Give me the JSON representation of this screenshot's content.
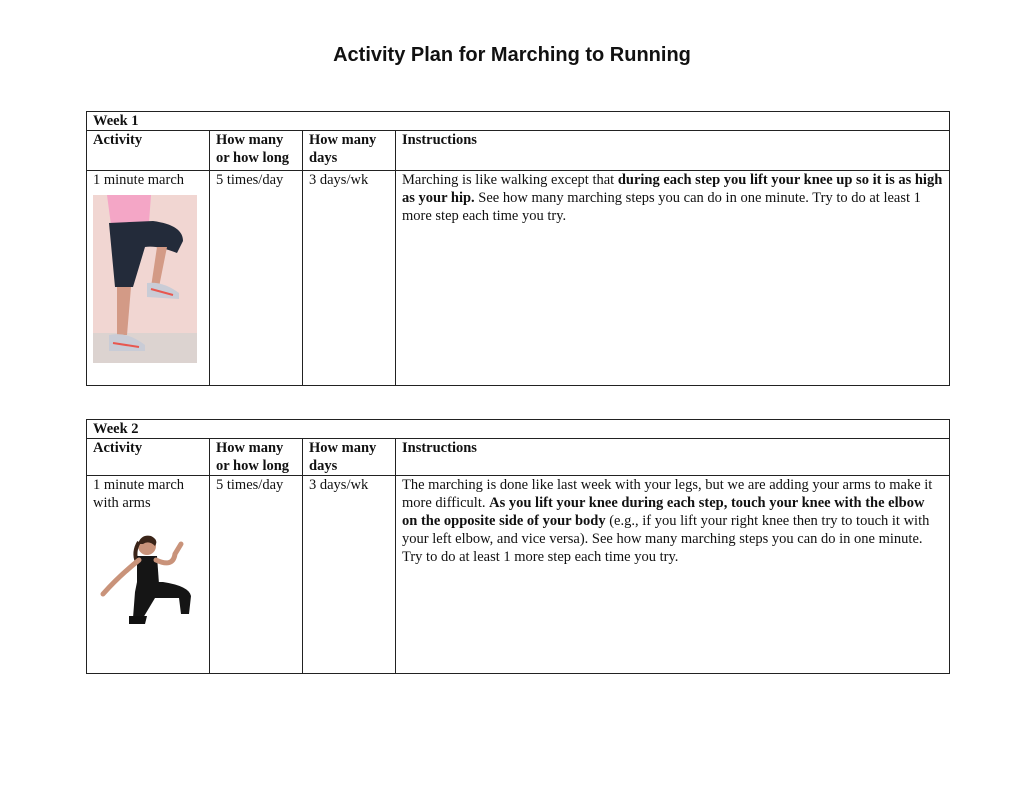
{
  "document": {
    "title": "Activity Plan for Marching to Running"
  },
  "headers": {
    "activity": "Activity",
    "how_many_line1": "How many",
    "how_many_line2": "or how long",
    "days_line1": "How many",
    "days_line2": "days",
    "instructions": "Instructions"
  },
  "weeks": [
    {
      "label": "Week 1",
      "activity_line1": "1 minute march",
      "activity_line2": "",
      "how_many": "5 times/day",
      "days": "3 days/wk",
      "instructions": {
        "p1": "Marching is like walking except that ",
        "b1": "during each step you lift your knee up so it is as high as your hip.",
        "p2": " See how many marching steps you can do in one minute. Try to do at least 1 more step each time you try."
      }
    },
    {
      "label": "Week 2",
      "activity_line1": "1 minute march",
      "activity_line2": "with arms",
      "how_many": "5 times/day",
      "days": "3 days/wk",
      "instructions": {
        "p1": "The marching is done like last week with your legs, but we are adding your arms to make it more difficult. ",
        "b1": "As you lift your knee during each step, touch your knee with the elbow on the opposite side of your body",
        "p2": " (e.g., if you lift your right knee then try to touch it with your left elbow, and vice versa). See how many marching steps you can do in one minute. Try to do at least 1 more step each time you try."
      }
    }
  ]
}
